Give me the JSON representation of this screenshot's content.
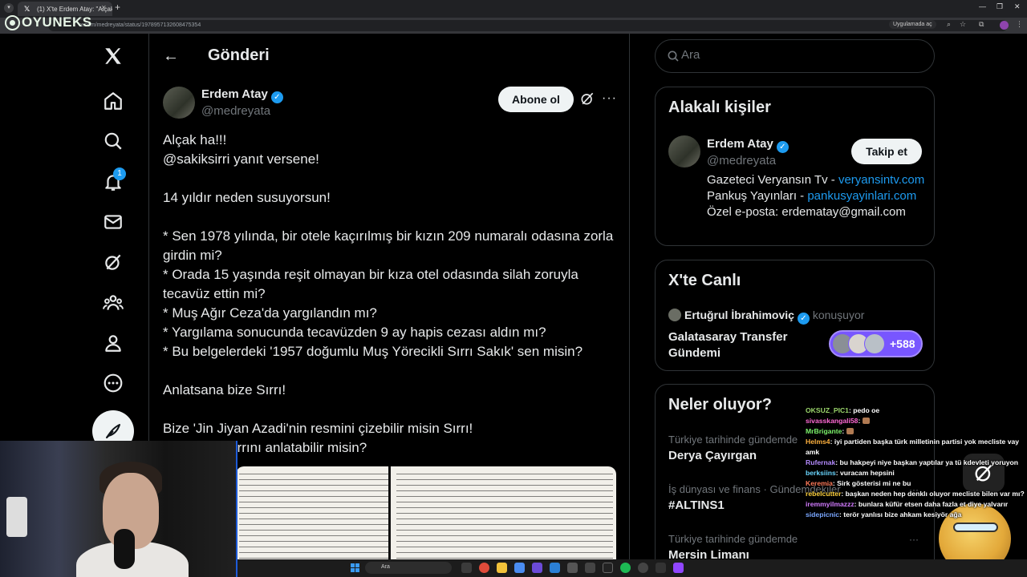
{
  "browser": {
    "tab_title": "(1) X'te Erdem Atay: \"Alçak ha!!!",
    "url": "x.com/medreyata/status/1978957132608475354",
    "open_in_app": "Uygulamada aç"
  },
  "watermark": {
    "logo_text": "OYUNEKS"
  },
  "nav": {
    "notification_count": "1"
  },
  "post": {
    "header_title": "Gönderi",
    "author_name": "Erdem Atay",
    "author_handle": "@medreyata",
    "subscribe_label": "Abone ol",
    "text": "Alçak ha!!!\n@sakiksirri yanıt versene!\n\n14 yıldır neden susuyorsun!\n\n* Sen 1978 yılında, bir otele kaçırılmış bir kızın 209 numaralı odasına zorla girdin mi?\n* Orada 15 yaşında reşit olmayan bir kıza otel odasında silah zoruyla tecavüz ettin mi?\n* Muş Ağır Ceza'da yargılandın mı?\n* Yargılama sonucunda tecavüzden 9 ay hapis cezası aldın mı?\n* Bu belgelerdeki '1957 doğumlu Muş Yörecikli Sırrı Sakık' sen misin?\n\nAnlatsana bize Sırrı!\n\nBize 'Jin Jiyan Azadi'nin resmini çizebilir misin Sırrı!\nAnlatabilir sırrını anlatabilir misin?"
  },
  "sidebar": {
    "search_placeholder": "Ara",
    "related": {
      "title": "Alakalı kişiler",
      "name": "Erdem Atay",
      "handle": "@medreyata",
      "follow_label": "Takip et",
      "bio_1": "Gazeteci Veryansın Tv - ",
      "bio_link_1": "veryansintv.com",
      "bio_2": " Pankuş Yayınları - ",
      "bio_link_2": "pankusyayinlari.com",
      "bio_3": " Özel e-posta: erdematay@gmail.com"
    },
    "live": {
      "title": "X'te Canlı",
      "host": "Ertuğrul İbrahimoviç",
      "status": "konuşuyor",
      "space_title": "Galatasaray Transfer Gündemi",
      "listener_count": "+588"
    },
    "trends": {
      "title": "Neler oluyor?",
      "items": [
        {
          "meta": "Türkiye tarihinde gündemde",
          "name": "Derya Çayırgan"
        },
        {
          "meta": "İş dünyası ve finans · Gündemdekiler",
          "name": "#ALTINS1"
        },
        {
          "meta": "Türkiye tarihinde gündemde",
          "name": "Mersin Limanı"
        }
      ]
    }
  },
  "chat": [
    {
      "user": "OKSUZ_PIC1",
      "color": "#9bd66b",
      "msg": ": pedo oe"
    },
    {
      "user": "sivasskangali58",
      "color": "#ff6ad5",
      "msg": ": "
    },
    {
      "user": "MrBrigante",
      "color": "#7cf26b",
      "msg": ": "
    },
    {
      "user": "Helms4",
      "color": "#ffb23f",
      "msg": ": iyi partiden başka türk milletinin partisi yok mecliste vay amk"
    },
    {
      "user": "Rufernak",
      "color": "#b58cff",
      "msg": ": bu hakpeyi niye başkan yaptılar ya tü kdevleti yoruyon"
    },
    {
      "user": "berksiins",
      "color": "#6ad6ff",
      "msg": ": vuracam hepsini"
    },
    {
      "user": "Keremia",
      "color": "#ff7a59",
      "msg": ": Sirk gösterisi mi ne bu"
    },
    {
      "user": "rebelcutter",
      "color": "#ffd23f",
      "msg": ": başkan neden hep denklı oluyor mecliste bilen var mı?"
    },
    {
      "user": "iremmyilmazzz",
      "color": "#d27bff",
      "msg": ": bunlara küfür etsen daha fazla et diye yalvarır"
    },
    {
      "user": "sidepicnic",
      "color": "#7aa7ff",
      "msg": ": terör yanlısı bize ahkam kesiyör ağa"
    }
  ],
  "taskbar": {
    "search_placeholder": "Ara"
  }
}
